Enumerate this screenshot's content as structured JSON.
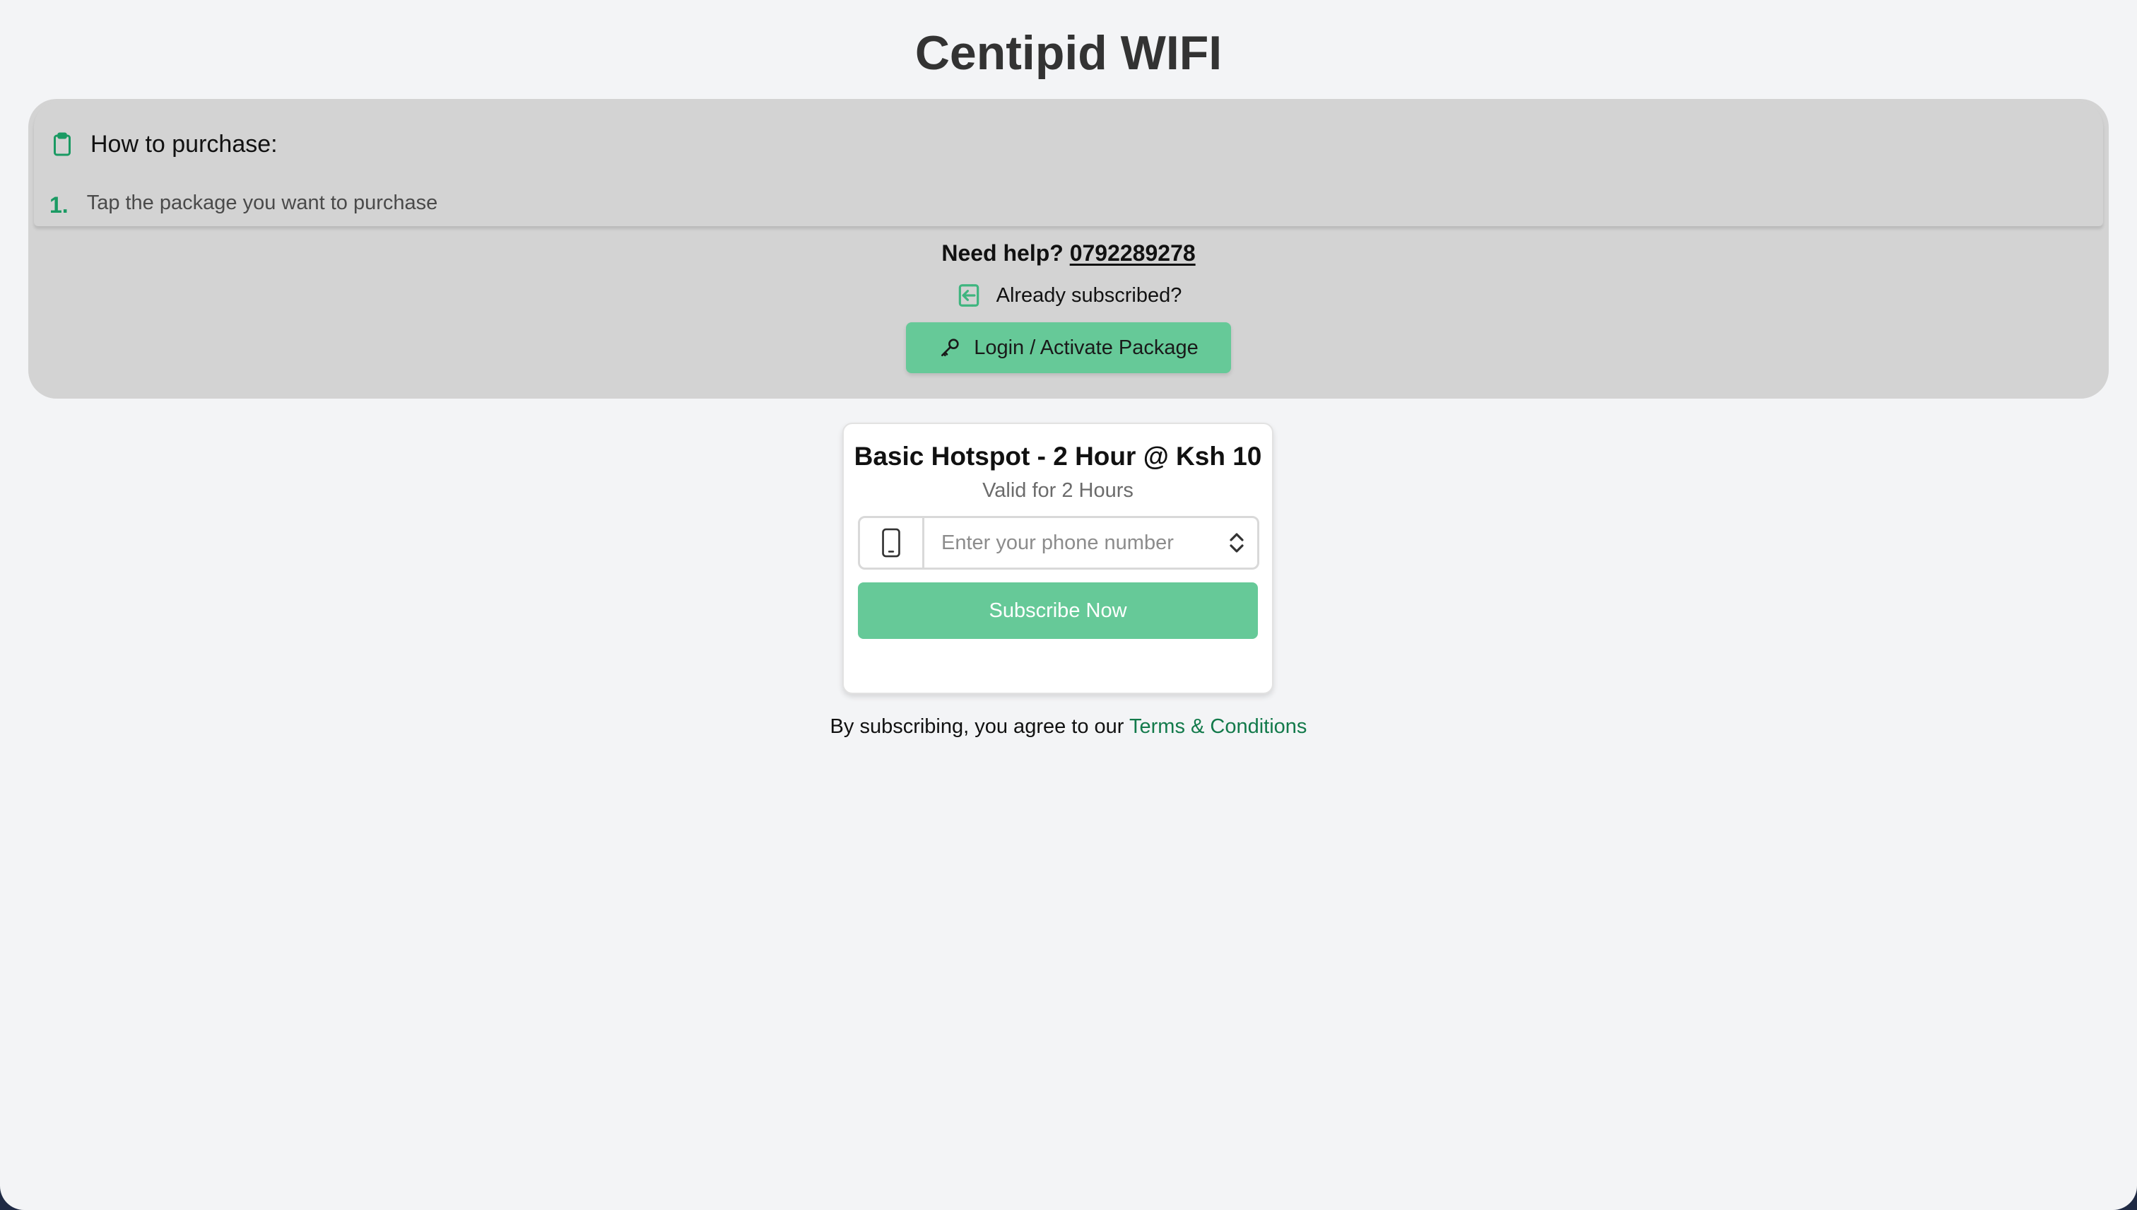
{
  "header": {
    "title": "Centipid WIFI"
  },
  "instructions": {
    "heading": "How to purchase:",
    "icon": "clipboard-icon",
    "steps": [
      {
        "number": "1.",
        "text": "Tap the package you want to purchase"
      }
    ]
  },
  "help": {
    "label": "Need help?",
    "phone": "0792289278"
  },
  "login": {
    "prompt": "Already subscribed?",
    "prompt_icon": "sign-in-icon",
    "button_label": "Login / Activate Package",
    "button_icon": "key-icon"
  },
  "package": {
    "name": "Basic Hotspot - 2 Hour @ Ksh 10",
    "validity": "Valid for 2 Hours",
    "phone_placeholder": "Enter your phone number",
    "phone_value": "",
    "phone_icon": "mobile-phone-icon",
    "subscribe_label": "Subscribe Now"
  },
  "terms": {
    "prefix": "By subscribing, you agree to our",
    "link_label": "Terms & Conditions"
  },
  "colors": {
    "accent": "#66c998",
    "accent_dark": "#1a9a63",
    "panel_bg": "#d3d3d3",
    "page_bg": "#f3f4f6",
    "link": "#137a4b"
  }
}
